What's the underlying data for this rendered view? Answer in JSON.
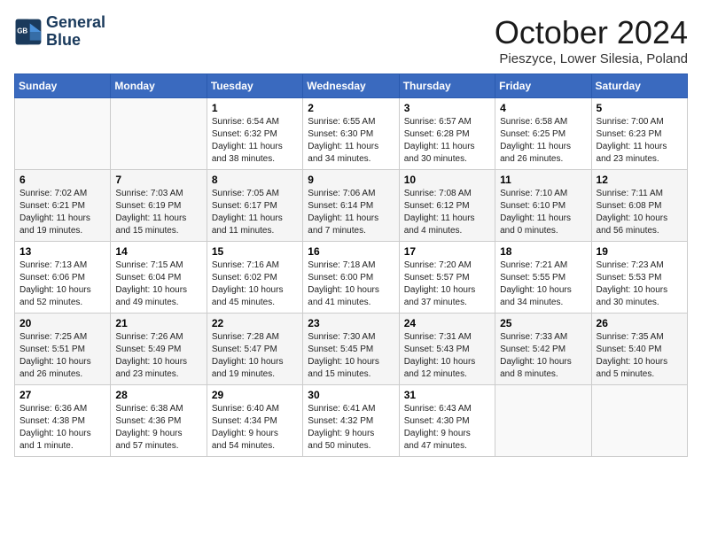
{
  "header": {
    "logo_line1": "General",
    "logo_line2": "Blue",
    "month": "October 2024",
    "location": "Pieszyce, Lower Silesia, Poland"
  },
  "weekdays": [
    "Sunday",
    "Monday",
    "Tuesday",
    "Wednesday",
    "Thursday",
    "Friday",
    "Saturday"
  ],
  "weeks": [
    [
      {
        "day": "",
        "info": ""
      },
      {
        "day": "",
        "info": ""
      },
      {
        "day": "1",
        "info": "Sunrise: 6:54 AM\nSunset: 6:32 PM\nDaylight: 11 hours\nand 38 minutes."
      },
      {
        "day": "2",
        "info": "Sunrise: 6:55 AM\nSunset: 6:30 PM\nDaylight: 11 hours\nand 34 minutes."
      },
      {
        "day": "3",
        "info": "Sunrise: 6:57 AM\nSunset: 6:28 PM\nDaylight: 11 hours\nand 30 minutes."
      },
      {
        "day": "4",
        "info": "Sunrise: 6:58 AM\nSunset: 6:25 PM\nDaylight: 11 hours\nand 26 minutes."
      },
      {
        "day": "5",
        "info": "Sunrise: 7:00 AM\nSunset: 6:23 PM\nDaylight: 11 hours\nand 23 minutes."
      }
    ],
    [
      {
        "day": "6",
        "info": "Sunrise: 7:02 AM\nSunset: 6:21 PM\nDaylight: 11 hours\nand 19 minutes."
      },
      {
        "day": "7",
        "info": "Sunrise: 7:03 AM\nSunset: 6:19 PM\nDaylight: 11 hours\nand 15 minutes."
      },
      {
        "day": "8",
        "info": "Sunrise: 7:05 AM\nSunset: 6:17 PM\nDaylight: 11 hours\nand 11 minutes."
      },
      {
        "day": "9",
        "info": "Sunrise: 7:06 AM\nSunset: 6:14 PM\nDaylight: 11 hours\nand 7 minutes."
      },
      {
        "day": "10",
        "info": "Sunrise: 7:08 AM\nSunset: 6:12 PM\nDaylight: 11 hours\nand 4 minutes."
      },
      {
        "day": "11",
        "info": "Sunrise: 7:10 AM\nSunset: 6:10 PM\nDaylight: 11 hours\nand 0 minutes."
      },
      {
        "day": "12",
        "info": "Sunrise: 7:11 AM\nSunset: 6:08 PM\nDaylight: 10 hours\nand 56 minutes."
      }
    ],
    [
      {
        "day": "13",
        "info": "Sunrise: 7:13 AM\nSunset: 6:06 PM\nDaylight: 10 hours\nand 52 minutes."
      },
      {
        "day": "14",
        "info": "Sunrise: 7:15 AM\nSunset: 6:04 PM\nDaylight: 10 hours\nand 49 minutes."
      },
      {
        "day": "15",
        "info": "Sunrise: 7:16 AM\nSunset: 6:02 PM\nDaylight: 10 hours\nand 45 minutes."
      },
      {
        "day": "16",
        "info": "Sunrise: 7:18 AM\nSunset: 6:00 PM\nDaylight: 10 hours\nand 41 minutes."
      },
      {
        "day": "17",
        "info": "Sunrise: 7:20 AM\nSunset: 5:57 PM\nDaylight: 10 hours\nand 37 minutes."
      },
      {
        "day": "18",
        "info": "Sunrise: 7:21 AM\nSunset: 5:55 PM\nDaylight: 10 hours\nand 34 minutes."
      },
      {
        "day": "19",
        "info": "Sunrise: 7:23 AM\nSunset: 5:53 PM\nDaylight: 10 hours\nand 30 minutes."
      }
    ],
    [
      {
        "day": "20",
        "info": "Sunrise: 7:25 AM\nSunset: 5:51 PM\nDaylight: 10 hours\nand 26 minutes."
      },
      {
        "day": "21",
        "info": "Sunrise: 7:26 AM\nSunset: 5:49 PM\nDaylight: 10 hours\nand 23 minutes."
      },
      {
        "day": "22",
        "info": "Sunrise: 7:28 AM\nSunset: 5:47 PM\nDaylight: 10 hours\nand 19 minutes."
      },
      {
        "day": "23",
        "info": "Sunrise: 7:30 AM\nSunset: 5:45 PM\nDaylight: 10 hours\nand 15 minutes."
      },
      {
        "day": "24",
        "info": "Sunrise: 7:31 AM\nSunset: 5:43 PM\nDaylight: 10 hours\nand 12 minutes."
      },
      {
        "day": "25",
        "info": "Sunrise: 7:33 AM\nSunset: 5:42 PM\nDaylight: 10 hours\nand 8 minutes."
      },
      {
        "day": "26",
        "info": "Sunrise: 7:35 AM\nSunset: 5:40 PM\nDaylight: 10 hours\nand 5 minutes."
      }
    ],
    [
      {
        "day": "27",
        "info": "Sunrise: 6:36 AM\nSunset: 4:38 PM\nDaylight: 10 hours\nand 1 minute."
      },
      {
        "day": "28",
        "info": "Sunrise: 6:38 AM\nSunset: 4:36 PM\nDaylight: 9 hours\nand 57 minutes."
      },
      {
        "day": "29",
        "info": "Sunrise: 6:40 AM\nSunset: 4:34 PM\nDaylight: 9 hours\nand 54 minutes."
      },
      {
        "day": "30",
        "info": "Sunrise: 6:41 AM\nSunset: 4:32 PM\nDaylight: 9 hours\nand 50 minutes."
      },
      {
        "day": "31",
        "info": "Sunrise: 6:43 AM\nSunset: 4:30 PM\nDaylight: 9 hours\nand 47 minutes."
      },
      {
        "day": "",
        "info": ""
      },
      {
        "day": "",
        "info": ""
      }
    ]
  ]
}
